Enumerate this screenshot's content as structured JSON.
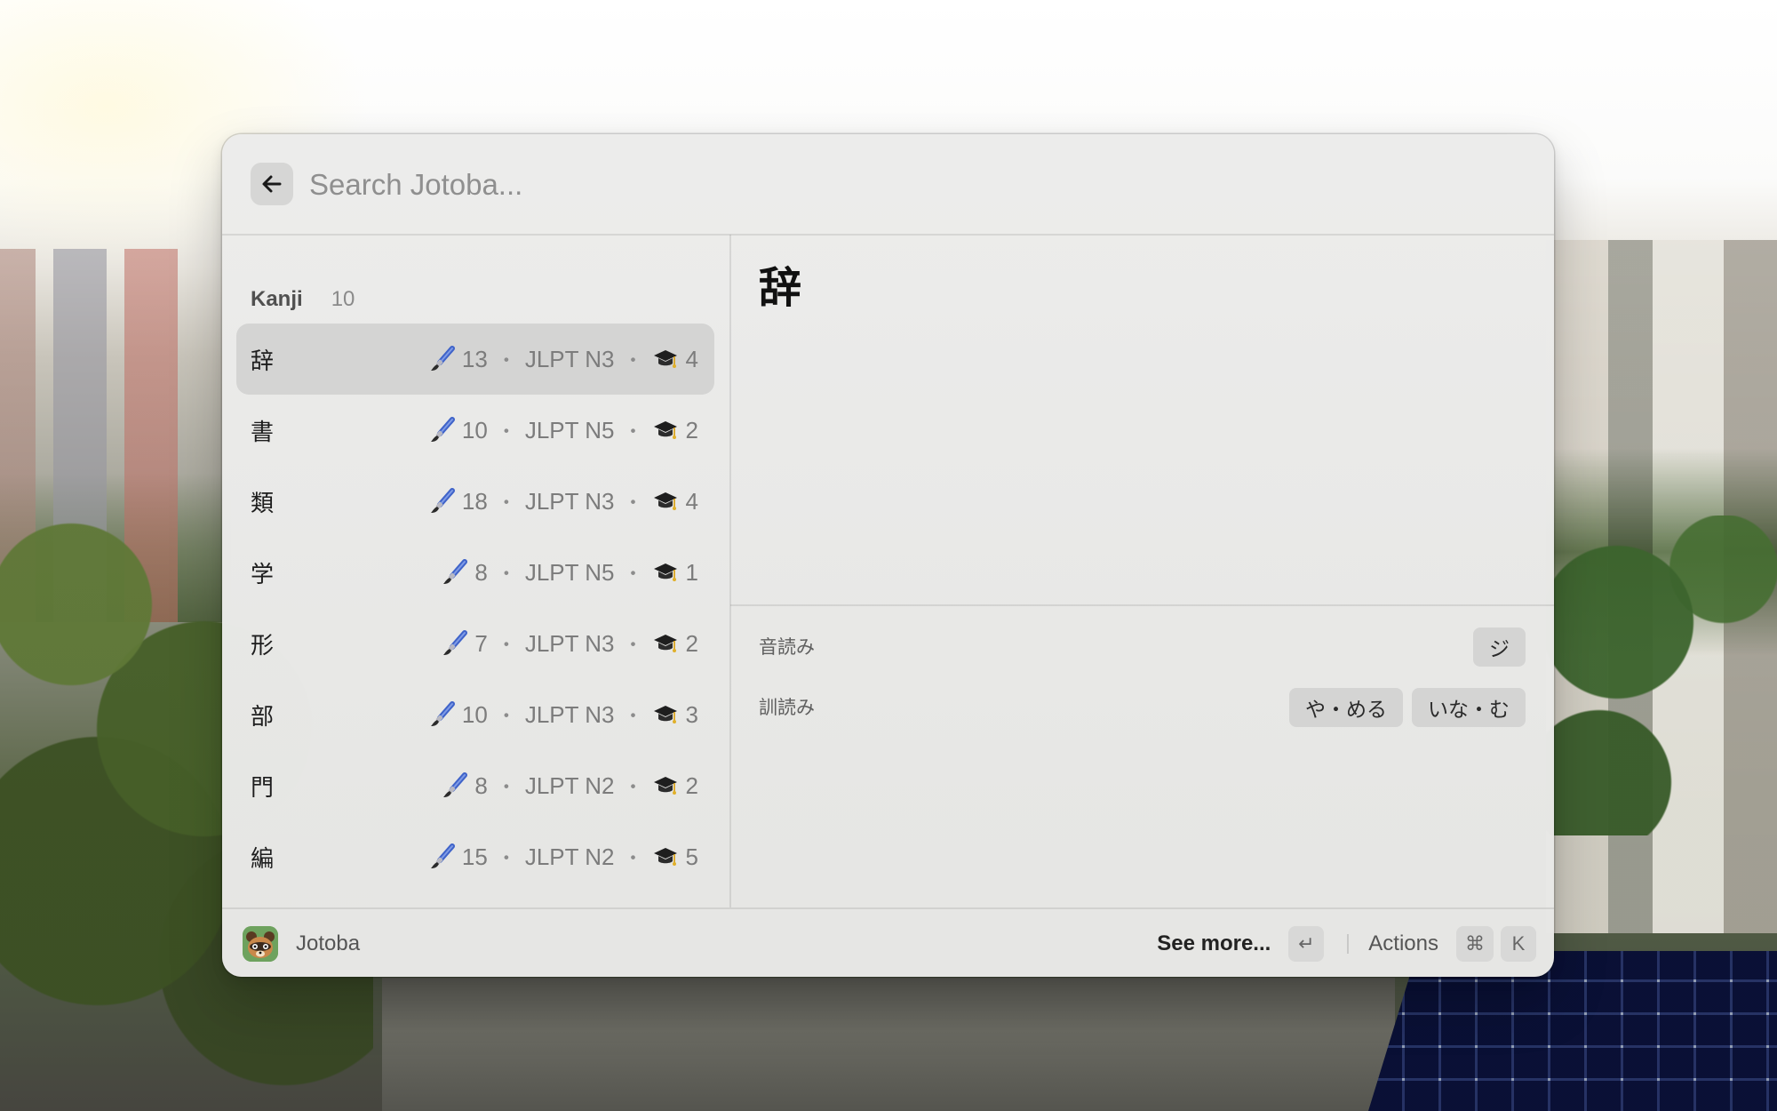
{
  "search": {
    "placeholder": "Search Jotoba..."
  },
  "list": {
    "section_title": "Kanji",
    "section_count": "10",
    "items": [
      {
        "kanji": "辞",
        "strokes": "13",
        "jlpt": "JLPT N3",
        "grade": "4",
        "selected": true
      },
      {
        "kanji": "書",
        "strokes": "10",
        "jlpt": "JLPT N5",
        "grade": "2"
      },
      {
        "kanji": "類",
        "strokes": "18",
        "jlpt": "JLPT N3",
        "grade": "4"
      },
      {
        "kanji": "学",
        "strokes": "8",
        "jlpt": "JLPT N5",
        "grade": "1"
      },
      {
        "kanji": "形",
        "strokes": "7",
        "jlpt": "JLPT N3",
        "grade": "2"
      },
      {
        "kanji": "部",
        "strokes": "10",
        "jlpt": "JLPT N3",
        "grade": "3"
      },
      {
        "kanji": "門",
        "strokes": "8",
        "jlpt": "JLPT N2",
        "grade": "2"
      },
      {
        "kanji": "編",
        "strokes": "15",
        "jlpt": "JLPT N2",
        "grade": "5"
      }
    ],
    "separator": "・",
    "icons": {
      "strokes": "paintbrush-icon",
      "grade": "graduation-cap-icon"
    }
  },
  "detail": {
    "kanji": "辞",
    "onyomi_label": "音読み",
    "onyomi": [
      "ジ"
    ],
    "kunyomi_label": "訓読み",
    "kunyomi": [
      "や・める",
      "いな・む"
    ]
  },
  "footer": {
    "app_name": "Jotoba",
    "primary_action": "See more...",
    "enter_key": "↵",
    "actions_label": "Actions",
    "cmd_key": "⌘",
    "k_key": "K"
  },
  "colors": {
    "window_bg": "#ececeb",
    "selected_row": "#d4d4d3",
    "tag_bg": "#d4d4d3",
    "kbd_bg": "#d8d8d7",
    "app_icon_bg": "#6ea25e"
  }
}
